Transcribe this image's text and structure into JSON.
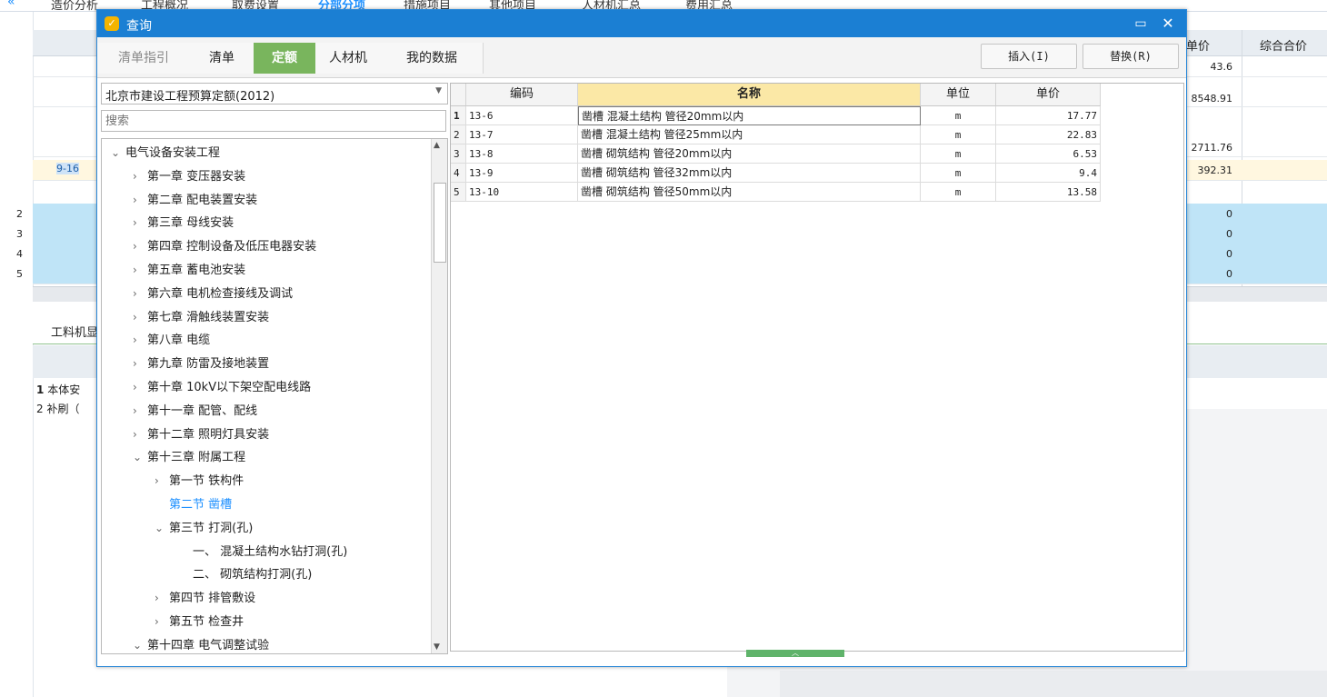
{
  "background_app": {
    "tabs": [
      "造价分析",
      "工程概况",
      "取费设置",
      "分部分项",
      "措施项目",
      "其他项目",
      "人材机汇总",
      "费用汇总"
    ],
    "active_tab": "分部分项",
    "header_right": [
      "单价",
      "综合合价"
    ],
    "row_values": [
      "43.6",
      "8548.91",
      "2711.76",
      "392.31",
      "0",
      "0",
      "0",
      "0"
    ],
    "row_indices": [
      "2",
      "3",
      "4",
      "5"
    ],
    "row_code": "9-16",
    "lower_tab": "工料机显",
    "lower_rows": [
      {
        "idx": "1",
        "text": "本体安"
      },
      {
        "idx": "2",
        "text": "补刷（"
      }
    ]
  },
  "dialog": {
    "title": "查询",
    "tabs": [
      {
        "label": "清单指引",
        "state": "disabled"
      },
      {
        "label": "清单",
        "state": "normal"
      },
      {
        "label": "定额",
        "state": "active"
      },
      {
        "label": "人材机",
        "state": "normal"
      },
      {
        "label": "我的数据",
        "state": "normal"
      }
    ],
    "insert_label": "插入(I)",
    "replace_label": "替换(R)",
    "library_select": "北京市建设工程预算定额(2012)",
    "search_placeholder": "搜索",
    "tree": [
      {
        "level": 0,
        "expanded": true,
        "label": "电气设备安装工程"
      },
      {
        "level": 1,
        "expanded": false,
        "label": "第一章 变压器安装"
      },
      {
        "level": 1,
        "expanded": false,
        "label": "第二章 配电装置安装"
      },
      {
        "level": 1,
        "expanded": false,
        "label": "第三章 母线安装"
      },
      {
        "level": 1,
        "expanded": false,
        "label": "第四章 控制设备及低压电器安装"
      },
      {
        "level": 1,
        "expanded": false,
        "label": "第五章 蓄电池安装"
      },
      {
        "level": 1,
        "expanded": false,
        "label": "第六章 电机检查接线及调试"
      },
      {
        "level": 1,
        "expanded": false,
        "label": "第七章 滑触线装置安装"
      },
      {
        "level": 1,
        "expanded": false,
        "label": "第八章 电缆"
      },
      {
        "level": 1,
        "expanded": false,
        "label": "第九章 防雷及接地装置"
      },
      {
        "level": 1,
        "expanded": false,
        "label": "第十章 10kV以下架空配电线路"
      },
      {
        "level": 1,
        "expanded": false,
        "label": "第十一章 配管、配线"
      },
      {
        "level": 1,
        "expanded": false,
        "label": "第十二章 照明灯具安装"
      },
      {
        "level": 1,
        "expanded": true,
        "label": "第十三章 附属工程"
      },
      {
        "level": 2,
        "expanded": false,
        "label": "第一节 铁构件"
      },
      {
        "level": 2,
        "leaf": true,
        "selected": true,
        "label": "第二节 凿槽"
      },
      {
        "level": 2,
        "expanded": true,
        "label": "第三节 打洞(孔)"
      },
      {
        "level": 3,
        "leaf": true,
        "label": "一、 混凝土结构水钻打洞(孔)"
      },
      {
        "level": 3,
        "leaf": true,
        "label": "二、 砌筑结构打洞(孔)"
      },
      {
        "level": 2,
        "expanded": false,
        "label": "第四节 排管敷设"
      },
      {
        "level": 2,
        "expanded": false,
        "label": "第五节 检查井"
      },
      {
        "level": 1,
        "expanded": true,
        "label": "第十四章 电气调整试验"
      }
    ],
    "grid": {
      "columns": [
        "编码",
        "名称",
        "单位",
        "单价"
      ],
      "sorted_column": "名称",
      "rows": [
        {
          "idx": "1",
          "code": "13-6",
          "name": "凿槽 混凝土结构 管径20mm以内",
          "unit": "m",
          "price": "17.77"
        },
        {
          "idx": "2",
          "code": "13-7",
          "name": "凿槽 混凝土结构 管径25mm以内",
          "unit": "m",
          "price": "22.83"
        },
        {
          "idx": "3",
          "code": "13-8",
          "name": "凿槽 砌筑结构 管径20mm以内",
          "unit": "m",
          "price": "6.53"
        },
        {
          "idx": "4",
          "code": "13-9",
          "name": "凿槽 砌筑结构 管径32mm以内",
          "unit": "m",
          "price": "9.4"
        },
        {
          "idx": "5",
          "code": "13-10",
          "name": "凿槽 砌筑结构 管径50mm以内",
          "unit": "m",
          "price": "13.58"
        }
      ]
    }
  },
  "icons": {
    "app": "app-logo-icon",
    "maximize": "maximize-icon",
    "close": "close-icon",
    "collapse": "double-chevron-left-icon"
  },
  "colors": {
    "titlebar": "#1b7fd3",
    "active_tab": "#79b55d",
    "sorted_header": "#fbe8a6",
    "selected_tree": "#1e90ff",
    "background_row_highlight": "#bfe4f7"
  }
}
